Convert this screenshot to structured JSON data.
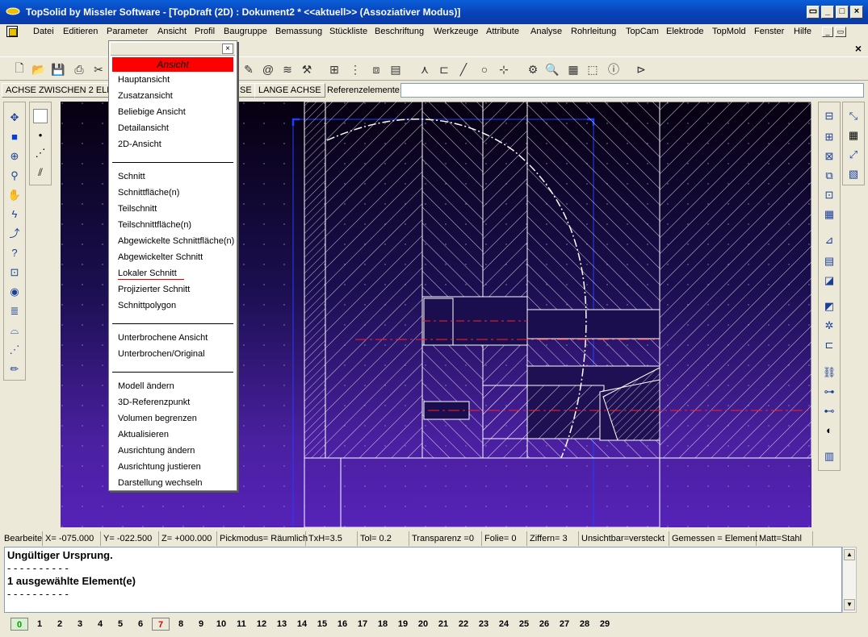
{
  "window": {
    "title": "TopSolid by Missler Software - [TopDraft (2D) : Dokument2 *  <<aktuell>> (Assoziativer Modus)]",
    "controls": [
      "restore-doc",
      "minimize",
      "maximize",
      "close"
    ]
  },
  "menubar": {
    "items": [
      "Datei",
      "Editieren",
      "Parameter",
      "Ansicht",
      "Profil",
      "Baugruppe",
      "Bemassung",
      "Stückliste",
      "Beschriftung",
      "Werkzeuge",
      "Attribute",
      "Analyse",
      "Rohrleitung",
      "TopCam",
      "Elektrode",
      "TopMold",
      "Fenster",
      "Hilfe"
    ]
  },
  "cmdbar": {
    "active_command": "ACHSE ZWISCHEN 2 ELEMENTEN",
    "btn_short": "SE",
    "btn_long": "LANGE ACHSE",
    "ref_label": "Referenzelemente:",
    "ref_value": ""
  },
  "popup": {
    "header": "Ansicht",
    "groups": [
      [
        "Hauptansicht",
        "Zusatzansicht",
        "Beliebige Ansicht",
        "Detailansicht",
        "2D-Ansicht"
      ],
      [
        "Schnitt",
        "Schnittfläche(n)",
        "Teilschnitt",
        "Teilschnittfläche(n)",
        "Abgewickelte Schnittfläche(n)",
        "Abgewickelter Schnitt",
        "Lokaler Schnitt",
        "Projizierter Schnitt",
        "Schnittpolygon"
      ],
      [
        "Unterbrochene Ansicht",
        "Unterbrochen/Original"
      ],
      [
        "Modell ändern",
        "3D-Referenzpunkt",
        "Volumen begrenzen",
        "Aktualisieren",
        "Ausrichtung ändern",
        "Ausrichtung justieren",
        "Darstellung wechseln"
      ]
    ],
    "highlighted": "Lokaler Schnitt"
  },
  "status": {
    "cells": [
      "Bearbeite",
      "X= -075.000",
      "Y= -022.500",
      "Z= +000.000",
      "Pickmodus= Räumlich",
      "TxH=3.5",
      "Tol=   0.2",
      "Transparenz =0",
      "Folie=  0",
      "Ziffern= 3",
      "Unsichtbar=versteckt",
      "Gemessen = Element",
      "Matt=Stahl"
    ]
  },
  "console": {
    "lines": [
      "Ungültiger Ursprung.",
      "- - - - - - - - - -",
      "1 ausgewählte Element(e)",
      "- - - - - - - - - -"
    ]
  },
  "pages": {
    "tabs": [
      "0",
      "1",
      "2",
      "3",
      "4",
      "5",
      "6",
      "7",
      "8",
      "9",
      "10",
      "11",
      "12",
      "13",
      "14",
      "15",
      "16",
      "17",
      "18",
      "19",
      "20",
      "21",
      "22",
      "23",
      "24",
      "25",
      "26",
      "27",
      "28",
      "29"
    ],
    "active": "0",
    "current": "7"
  },
  "colors": {
    "title_bar": "#0842b8",
    "popup_header": "#ff0000",
    "canvas_top": "#060010",
    "canvas_bottom": "#5622b8",
    "drawing_line": "#ffffff",
    "center_line": "#ff2020",
    "frame": "#2040ff"
  }
}
